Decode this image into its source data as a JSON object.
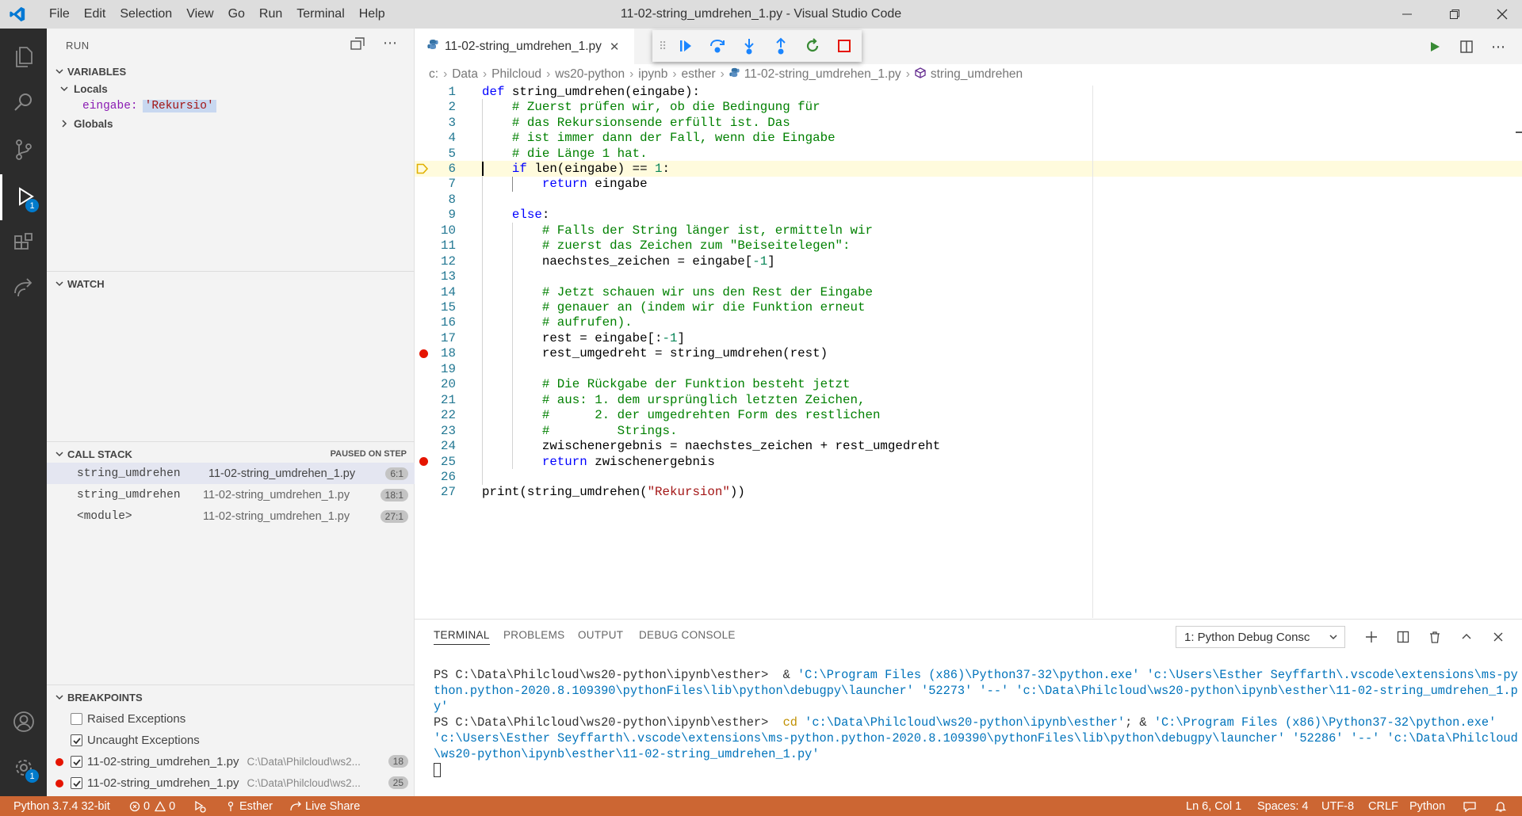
{
  "window": {
    "title": "11-02-string_umdrehen_1.py - Visual Studio Code"
  },
  "menu": [
    "File",
    "Edit",
    "Selection",
    "View",
    "Go",
    "Run",
    "Terminal",
    "Help"
  ],
  "activity": {
    "debug_badge": "1",
    "settings_badge": "1"
  },
  "sidebar": {
    "title": "RUN",
    "variables": {
      "header": "VARIABLES",
      "locals_label": "Locals",
      "var_name": "eingabe:",
      "var_value": "'Rekursio'",
      "globals_label": "Globals"
    },
    "watch": {
      "header": "WATCH"
    },
    "callstack": {
      "header": "CALL STACK",
      "status": "PAUSED ON STEP",
      "frames": [
        {
          "fn": "string_umdrehen",
          "file": "11-02-string_umdrehen_1.py",
          "pos": "6:1"
        },
        {
          "fn": "string_umdrehen",
          "file": "11-02-string_umdrehen_1.py",
          "pos": "18:1"
        },
        {
          "fn": "<module>",
          "file": "11-02-string_umdrehen_1.py",
          "pos": "27:1"
        }
      ]
    },
    "breakpoints": {
      "header": "BREAKPOINTS",
      "items": [
        {
          "label": "Raised Exceptions",
          "checked": false
        },
        {
          "label": "Uncaught Exceptions",
          "checked": true
        },
        {
          "label": "11-02-string_umdrehen_1.py",
          "path": "C:\\Data\\Philcloud\\ws2...",
          "line": "18",
          "checked": true
        },
        {
          "label": "11-02-string_umdrehen_1.py",
          "path": "C:\\Data\\Philcloud\\ws2...",
          "line": "25",
          "checked": true
        }
      ]
    }
  },
  "editor": {
    "tab_label": "11-02-string_umdrehen_1.py",
    "breadcrumb": [
      "c:",
      "Data",
      "Philcloud",
      "ws20-python",
      "ipynb",
      "esther",
      "11-02-string_umdrehen_1.py",
      "string_umdrehen"
    ],
    "current_line": 6,
    "breakpoint_lines": [
      18,
      25
    ],
    "lines": [
      "def string_umdrehen(eingabe):",
      "    # Zuerst prüfen wir, ob die Bedingung für",
      "    # das Rekursionsende erfüllt ist. Das",
      "    # ist immer dann der Fall, wenn die Eingabe",
      "    # die Länge 1 hat.",
      "    if len(eingabe) == 1:",
      "        return eingabe",
      "",
      "    else:",
      "        # Falls der String länger ist, ermitteln wir",
      "        # zuerst das Zeichen zum \"Beiseitelegen\":",
      "        naechstes_zeichen = eingabe[-1]",
      "",
      "        # Jetzt schauen wir uns den Rest der Eingabe",
      "        # genauer an (indem wir die Funktion erneut",
      "        # aufrufen).",
      "        rest = eingabe[:-1]",
      "        rest_umgedreht = string_umdrehen(rest)",
      "",
      "        # Die Rückgabe der Funktion besteht jetzt",
      "        # aus: 1. dem ursprünglich letzten Zeichen,",
      "        #      2. der umgedrehten Form des restlichen",
      "        #         Strings.",
      "        zwischenergebnis = naechstes_zeichen + rest_umgedreht",
      "        return zwischenergebnis",
      "",
      "print(string_umdrehen(\"Rekursion\"))"
    ]
  },
  "panel": {
    "tabs": [
      "TERMINAL",
      "PROBLEMS",
      "OUTPUT",
      "DEBUG CONSOLE"
    ],
    "terminal_select": "1: Python Debug Consc",
    "terminal": {
      "prompt1": "PS C:\\Data\\Philcloud\\ws20-python\\ipynb\\esther>",
      "cmd1_amp": "&",
      "cmd1_args": "'C:\\Program Files (x86)\\Python37-32\\python.exe' 'c:\\Users\\Esther Seyffarth\\.vscode\\extensions\\ms-python.python-2020.8.109390\\pythonFiles\\lib\\python\\debugpy\\launcher' '52273' '--' 'c:\\Data\\Philcloud\\ws20-python\\ipynb\\esther\\11-02-string_umdrehen_1.py'",
      "prompt2": "PS C:\\Data\\Philcloud\\ws20-python\\ipynb\\esther>",
      "cmd2_cd": "cd",
      "cmd2_path": "'c:\\Data\\Philcloud\\ws20-python\\ipynb\\esther'",
      "cmd2_sep": "; &",
      "cmd2_args": "'C:\\Program Files (x86)\\Python37-32\\python.exe' 'c:\\Users\\Esther Seyffarth\\.vscode\\extensions\\ms-python.python-2020.8.109390\\pythonFiles\\lib\\python\\debugpy\\launcher' '52286' '--' 'c:\\Data\\Philcloud\\ws20-python\\ipynb\\esther\\11-02-string_umdrehen_1.py'"
    }
  },
  "statusbar": {
    "python": "Python 3.7.4 32-bit",
    "errors": "0",
    "warnings": "0",
    "user": "Esther",
    "liveshare": "Live Share",
    "position": "Ln 6, Col 1",
    "spaces": "Spaces: 4",
    "encoding": "UTF-8",
    "eol": "CRLF",
    "language": "Python"
  },
  "colors": {
    "statusbar": "#cc6633",
    "activitybar": "#2c2c2c",
    "current_line": "#fffbdd",
    "breakpoint": "#e51400"
  }
}
